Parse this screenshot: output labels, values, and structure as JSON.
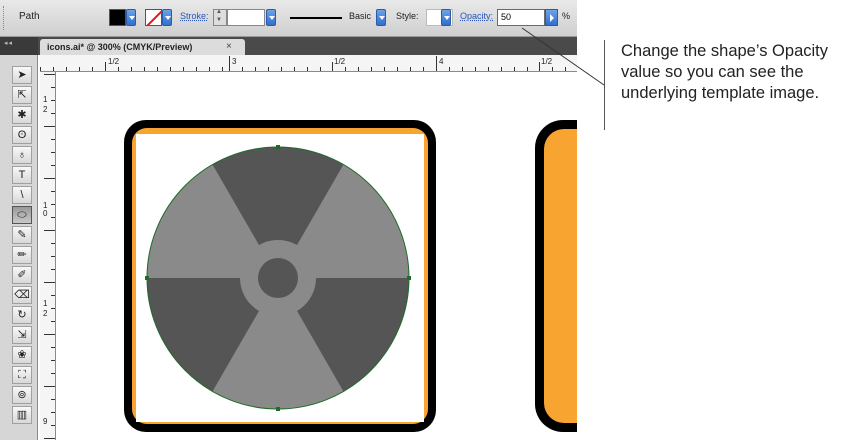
{
  "control_bar": {
    "selection_label": "Path",
    "stroke_label": "Stroke:",
    "stroke_value": "",
    "brush_label": "Basic",
    "style_label": "Style:",
    "opacity_label": "Opacity:",
    "opacity_value": "50",
    "opacity_unit": "%"
  },
  "document_tab": {
    "title": "icons.ai* @ 300% (CMYK/Preview)",
    "close_glyph": "×"
  },
  "ruler_top": [
    "1/2",
    "3",
    "1/2",
    "4",
    "1/2"
  ],
  "ruler_left": [
    "1",
    "2",
    "1",
    "0",
    "1",
    "2",
    "9"
  ],
  "tools": [
    "selection-tool",
    "direct-selection-tool",
    "magic-wand-tool",
    "lasso-tool",
    "pen-tool",
    "type-tool",
    "line-segment-tool",
    "ellipse-tool",
    "paintbrush-tool",
    "pencil-tool",
    "blob-brush-tool",
    "eraser-tool",
    "rotate-tool",
    "scale-tool",
    "warp-tool",
    "free-transform-tool",
    "symbol-sprayer-tool",
    "graph-tool"
  ],
  "tool_glyphs": [
    "➤",
    "⇱",
    "✱",
    "ʘ",
    "♁",
    "T",
    "\\",
    "⬭",
    "✎",
    "✏",
    "✐",
    "⌫",
    "↻",
    "⇲",
    "❀",
    "⛶",
    "⊚",
    "▥"
  ],
  "callout": {
    "text": "Change the shape’s Opacity value so you can see the underlying template image."
  },
  "colors": {
    "icon_frame": "#000000",
    "icon_background": "#f7a431",
    "radiation_circle": "#8a8a8a",
    "radiation_blades": "#555555",
    "path_anchor": "#1f6b2a"
  }
}
